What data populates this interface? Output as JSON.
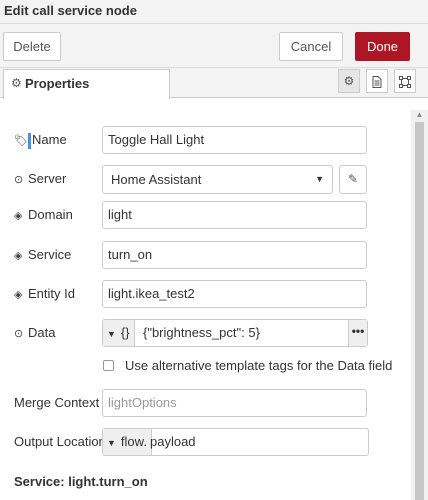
{
  "dialog": {
    "title": "Edit call service node",
    "delete_label": "Delete",
    "cancel_label": "Cancel",
    "done_label": "Done"
  },
  "tabs": {
    "properties_label": "Properties"
  },
  "form": {
    "name": {
      "label": "Name",
      "value": "Toggle Hall Light"
    },
    "server": {
      "label": "Server",
      "value": "Home Assistant"
    },
    "domain": {
      "label": "Domain",
      "value": "light"
    },
    "service": {
      "label": "Service",
      "value": "turn_on"
    },
    "entity_id": {
      "label": "Entity Id",
      "value": "light.ikea_test2"
    },
    "data": {
      "label": "Data",
      "type_symbol": "{}",
      "value": "{\"brightness_pct\": 5}",
      "more": "•••"
    },
    "alt_tags": {
      "label": "Use alternative template tags for the Data field",
      "checked": false
    },
    "merge_context": {
      "label": "Merge Context",
      "placeholder": "lightOptions"
    },
    "output_location": {
      "label": "Output Location",
      "type_label": "flow.",
      "value": "payload"
    }
  },
  "summary": {
    "service_text": "Service: light.turn_on"
  },
  "colors": {
    "accent": "#ad1625",
    "background": "#f3f3f3"
  }
}
